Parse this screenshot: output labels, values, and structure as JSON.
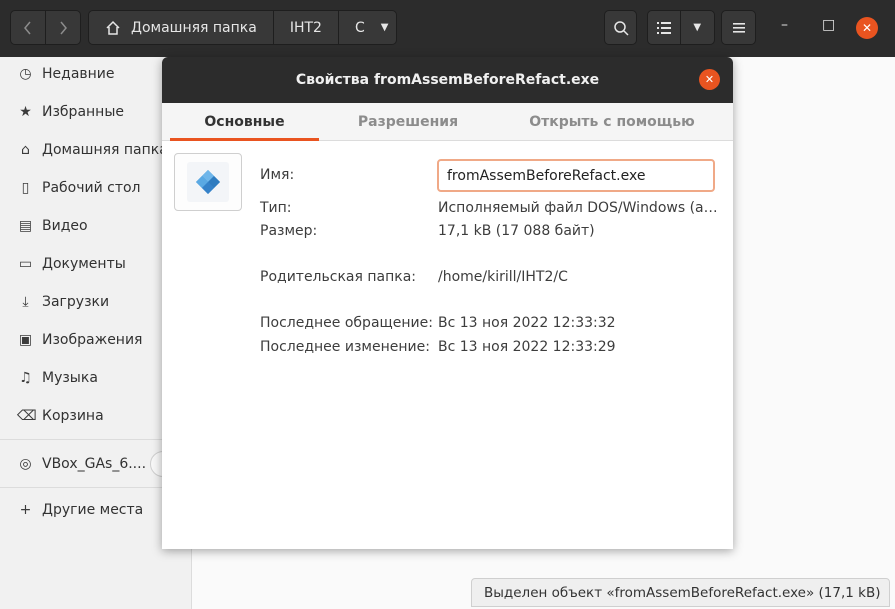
{
  "toolbar": {
    "back_icon": "chevron-left",
    "forward_icon": "chevron-right",
    "breadcrumbs": [
      "Домашняя папка",
      "IHT2",
      "C"
    ],
    "search_icon": "search",
    "view_icon": "list-view",
    "menu_icon": "hamburger"
  },
  "window_controls": {
    "minimize": "–",
    "maximize": "□",
    "close": "✕"
  },
  "sidebar": {
    "items": [
      {
        "label": "Недавние",
        "icon": "clock-icon"
      },
      {
        "label": "Избранные",
        "icon": "star-icon"
      },
      {
        "label": "Домашняя папка",
        "icon": "home-icon"
      },
      {
        "label": "Рабочий стол",
        "icon": "desktop-icon"
      },
      {
        "label": "Видео",
        "icon": "video-icon"
      },
      {
        "label": "Документы",
        "icon": "document-icon"
      },
      {
        "label": "Загрузки",
        "icon": "download-icon"
      },
      {
        "label": "Изображения",
        "icon": "image-icon"
      },
      {
        "label": "Музыка",
        "icon": "music-icon"
      },
      {
        "label": "Корзина",
        "icon": "trash-icon"
      }
    ],
    "device": {
      "label": "VBox_GAs_6....",
      "icon": "disc-icon"
    },
    "other": {
      "label": "Другие места",
      "icon": "plus-icon"
    }
  },
  "dialog": {
    "title": "Свойства fromAssemBeforeRefact.exe",
    "tabs": [
      "Основные",
      "Разрешения",
      "Открыть с помощью"
    ],
    "active_tab": "Основные",
    "fields": {
      "name_label": "Имя:",
      "name_value": "fromAssemBeforeRefact.exe",
      "type_label": "Тип:",
      "type_value": "Исполняемый файл DOS/Windows (a…",
      "size_label": "Размер:",
      "size_value": "17,1 kB (17 088 байт)",
      "parent_label": "Родительская папка:",
      "parent_value": "/home/kirill/IHT2/C",
      "accessed_label": "Последнее обращение:",
      "accessed_value": "Вс 13 ноя 2022 12:33:32",
      "modified_label": "Последнее изменение:",
      "modified_value": "Вс 13 ноя 2022 12:33:29"
    }
  },
  "statusbar": {
    "text": "Выделен объект «fromAssemBeforeRefact.exe»  (17,1 kB)"
  },
  "colors": {
    "accent": "#e95420",
    "headerbar": "#2c2c2c"
  }
}
